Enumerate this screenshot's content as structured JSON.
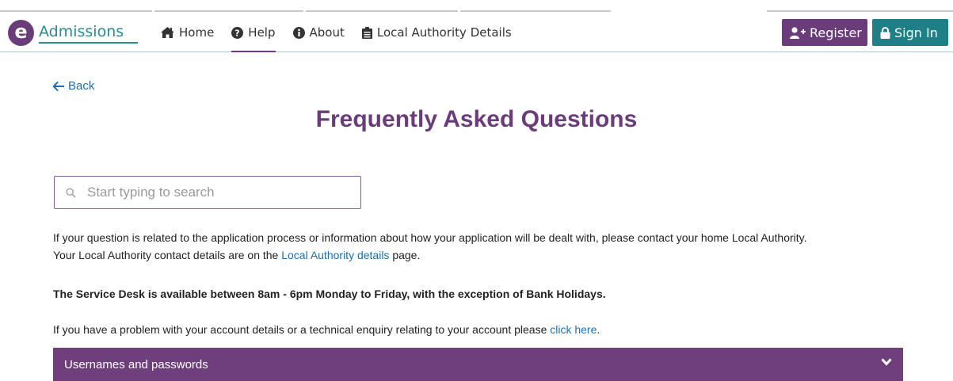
{
  "brand": {
    "badge": "e",
    "name": "Admissions"
  },
  "nav": {
    "home": "Home",
    "help": "Help",
    "about": "About",
    "la_details": "Local Authority Details",
    "active": "help"
  },
  "actions": {
    "register": "Register",
    "sign_in": "Sign In"
  },
  "back": "Back",
  "page_title": "Frequently Asked Questions",
  "search": {
    "placeholder": "Start typing to search",
    "value": ""
  },
  "intro": {
    "line1": "If your question is related to the application process or information about how your application will be dealt with, please contact your home Local Authority.",
    "line2_before": "Your Local Authority contact details are on the ",
    "line2_link": "Local Authority details",
    "line2_after": " page."
  },
  "service_desk": "The Service Desk is available between 8am - 6pm Monday to Friday, with the exception of Bank Holidays.",
  "account_help": {
    "before": "If you have a problem with your account details or a technical enquiry relating to your account please ",
    "link": "click here",
    "after": "."
  },
  "faq_sections": [
    {
      "title": "Usernames and passwords",
      "icon": "chevron-down-icon"
    }
  ],
  "colors": {
    "brand_purple": "#6a3d7a",
    "brand_teal": "#1e7f86",
    "link": "#1a6fb0"
  }
}
